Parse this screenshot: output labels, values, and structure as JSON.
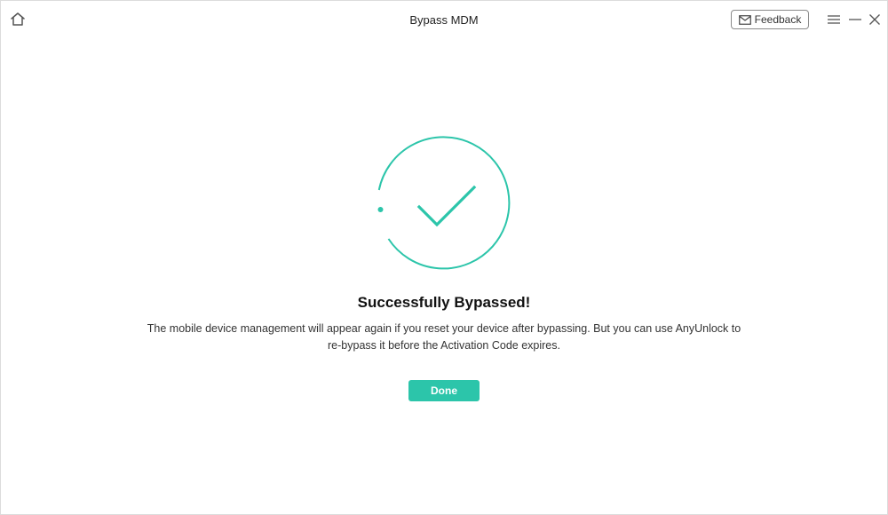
{
  "window": {
    "title": "Bypass MDM"
  },
  "toolbar": {
    "home_icon": "home-icon",
    "feedback_icon": "mail-icon",
    "feedback_label": "Feedback",
    "menu_icon": "hamburger-menu-icon",
    "minimize_icon": "minimize-icon",
    "close_icon": "close-icon"
  },
  "main": {
    "status_icon": "check-circle-icon",
    "headline": "Successfully Bypassed!",
    "description_line1": "The mobile device management will appear again if you reset your device after bypassing. But you can use AnyUnlock to",
    "description_line2": "re-bypass it before the Activation Code expires.",
    "done_label": "Done"
  },
  "colors": {
    "accent": "#2cc5aa",
    "text": "#222222",
    "border": "#dcdcdc"
  }
}
